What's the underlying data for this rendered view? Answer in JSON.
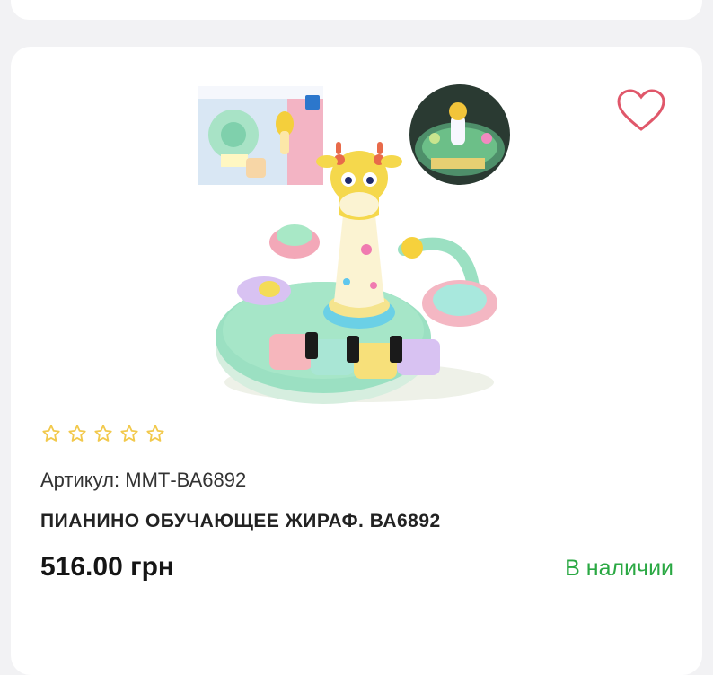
{
  "product": {
    "sku_label": "Артикул: ММТ-ВА6892",
    "title": "ПИАНИНО ОБУЧАЮЩЕЕ ЖИРАФ. ВА6892",
    "price": "516.00 грн",
    "availability": "В наличии",
    "rating_stars": 5,
    "rating_value": 0,
    "image_name": "giraffe-learning-piano-toy"
  },
  "icons": {
    "favorite": "heart-outline-icon",
    "rating": "star-outline-icon"
  },
  "colors": {
    "heart": "#e0576a",
    "star_outline": "#f2c94c",
    "availability": "#2aa843",
    "page_background": "#f2f2f4",
    "card_background": "#ffffff"
  }
}
